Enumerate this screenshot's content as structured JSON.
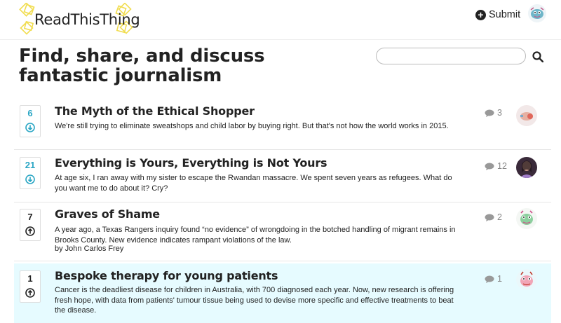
{
  "brand": {
    "name": "ReadThisThing"
  },
  "nav": {
    "submit_label": "Submit"
  },
  "page": {
    "title": "Find, share, and discuss fantastic journalism"
  },
  "search": {
    "value": "",
    "placeholder": ""
  },
  "stories": [
    {
      "votes": "6",
      "voted": true,
      "title": "The Myth of the Ethical Shopper",
      "description": "We're still trying to eliminate sweatshops and child labor by buying right. But that's not how the world works in 2015.",
      "byline": "",
      "comments": "3"
    },
    {
      "votes": "21",
      "voted": true,
      "title": "Everything is Yours, Everything is Not Yours",
      "description": "At age six, I ran away with my sister to escape the Rwandan massacre. We spent seven years as refugees. What do you want me to do about it? Cry?",
      "byline": "",
      "comments": "12"
    },
    {
      "votes": "7",
      "voted": false,
      "title": "Graves of Shame",
      "description": "A year ago, a Texas Rangers inquiry found “no evidence” of wrongdoing in the botched handling of migrant remains in Brooks County. New evidence indicates rampant violations of the law.",
      "byline": "by John Carlos Frey",
      "comments": "2"
    },
    {
      "votes": "1",
      "voted": false,
      "title": "Bespoke therapy for young patients",
      "description": "Cancer is the deadliest disease for children in Australia, with 700 diagnosed each year. Now, new research is offering fresh hope, with data from patients' tumour tissue being used to devise more specific and effective treatments to beat the disease.",
      "byline": "",
      "comments": "1"
    }
  ],
  "colors": {
    "accent": "#2aa6c4",
    "highlight_bg": "#e6fbff",
    "logo_yellow": "#f4e04d"
  }
}
